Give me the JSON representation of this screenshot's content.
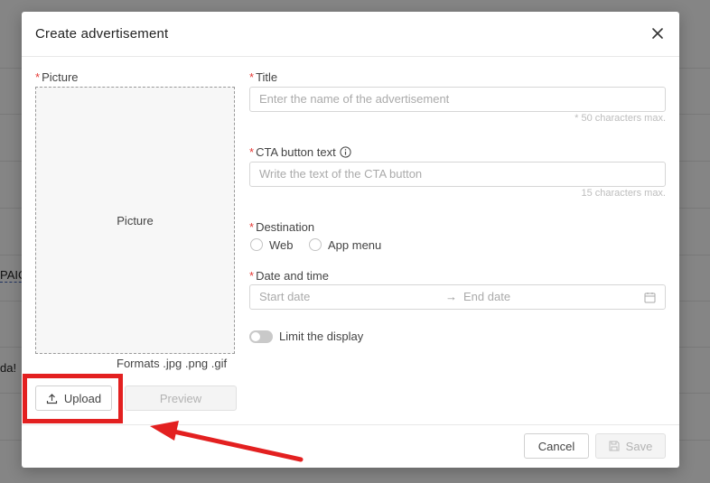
{
  "background": {
    "partial_texts": [
      "PAIC",
      "da!"
    ]
  },
  "modal": {
    "title": "Create advertisement",
    "picture": {
      "label": "Picture",
      "placeholder": "Picture",
      "formats": "Formats .jpg .png .gif"
    },
    "upload_label": "Upload",
    "preview_label": "Preview",
    "title_field": {
      "label": "Title",
      "placeholder": "Enter the name of the advertisement",
      "hint": "* 50 characters max."
    },
    "cta_field": {
      "label": "CTA button text",
      "placeholder": "Write the text of the CTA button",
      "hint": "15 characters max."
    },
    "destination": {
      "label": "Destination",
      "options": [
        "Web",
        "App menu"
      ]
    },
    "date_time": {
      "label": "Date and time",
      "start_placeholder": "Start date",
      "end_placeholder": "End date"
    },
    "limit_label": "Limit the display",
    "cancel_label": "Cancel",
    "save_label": "Save"
  },
  "colors": {
    "required": "#e53935",
    "annotation": "#e32020"
  }
}
